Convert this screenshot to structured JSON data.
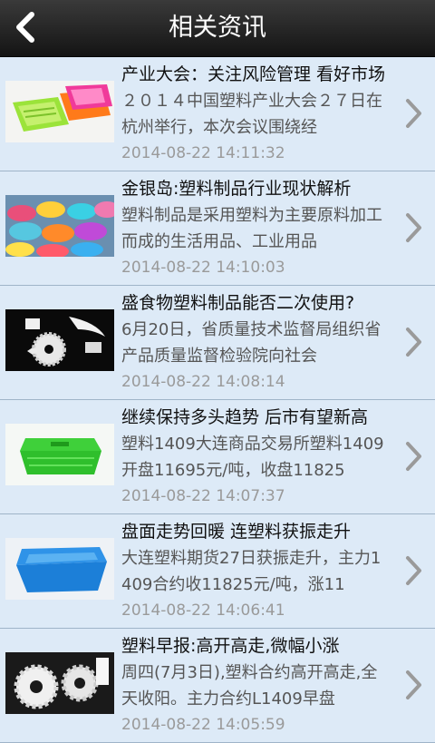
{
  "header": {
    "title": "相关资讯",
    "back_icon": "chevron-left-icon"
  },
  "news": [
    {
      "title": "产业大会：关注风险管理 看好市场",
      "summary": "２０１４中国塑料产业大会２７日在杭州举行，本次会议围绕经",
      "date": "2014-08-22 14:11:32"
    },
    {
      "title": "金银岛:塑料制品行业现状解析",
      "summary": "塑料制品是采用塑料为主要原料加工而成的生活用品、工业用品",
      "date": "2014-08-22 14:10:03"
    },
    {
      "title": "盛食物塑料制品能否二次使用?",
      "summary": "6月20日，省质量技术监督局组织省产品质量监督检验院向社会",
      "date": "2014-08-22 14:08:14"
    },
    {
      "title": "继续保持多头趋势 后市有望新高",
      "summary": "塑料1409大连商品交易所塑料1409开盘11695元/吨，收盘11825",
      "date": "2014-08-22 14:07:37"
    },
    {
      "title": "盘面走势回暖 连塑料获振走升",
      "summary": "大连塑料期货27日获振走升，主力1409合约收11825元/吨，涨11",
      "date": "2014-08-22 14:06:41"
    },
    {
      "title": "塑料早报:高开高走,微幅小涨",
      "summary": "周四(7月3日),塑料合约高开高走,全天收阳。主力合约L1409早盘",
      "date": "2014-08-22 14:05:59"
    }
  ]
}
